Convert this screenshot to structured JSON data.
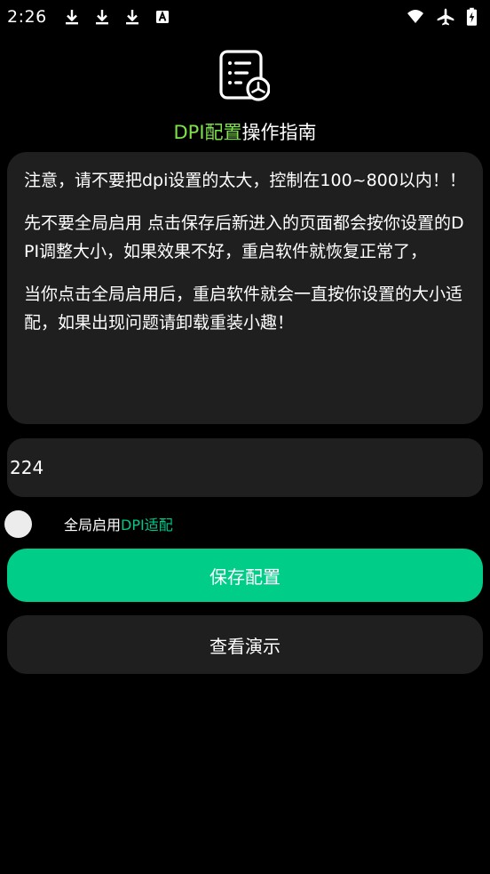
{
  "status_bar": {
    "time": "2:26",
    "left_icons": [
      "download-icon",
      "download-icon",
      "download-icon",
      "accessibility-a-icon"
    ],
    "right_icons": [
      "wifi-icon",
      "airplane-mode-icon",
      "battery-charging-icon"
    ]
  },
  "header": {
    "icon": "document-settings-icon",
    "title_accent": "DPI配置",
    "title_rest": "操作指南"
  },
  "notice": {
    "paragraphs": [
      "注意，请不要把dpi设置的太大，控制在100~800以内！！",
      "先不要全局启用 点击保存后新进入的页面都会按你设置的DPI调整大小，如果效果不好，重启软件就恢复正常了，",
      "当你点击全局启用后，重启软件就会一直按你设置的大小适配，如果出现问题请卸载重装小趣！"
    ]
  },
  "dpi_input": {
    "value": "224"
  },
  "global_toggle": {
    "label_prefix": "全局启用",
    "label_accent": "DPI适配"
  },
  "buttons": {
    "save_label": "保存配置",
    "demo_label": "查看演示"
  },
  "colors": {
    "background": "#000000",
    "card": "#1f1f1f",
    "title_accent": "#7ee24a",
    "toggle_accent": "#00c98a",
    "primary_button": "#00cd88"
  }
}
